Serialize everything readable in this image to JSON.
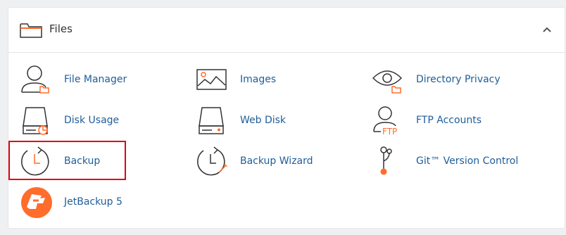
{
  "section": {
    "title": "Files",
    "items": [
      {
        "label": "File Manager",
        "icon": "file-manager-icon"
      },
      {
        "label": "Images",
        "icon": "images-icon"
      },
      {
        "label": "Directory Privacy",
        "icon": "directory-privacy-icon"
      },
      {
        "label": "Disk Usage",
        "icon": "disk-usage-icon"
      },
      {
        "label": "Web Disk",
        "icon": "web-disk-icon"
      },
      {
        "label": "FTP Accounts",
        "icon": "ftp-accounts-icon",
        "icon_text": "FTP"
      },
      {
        "label": "Backup",
        "icon": "backup-icon"
      },
      {
        "label": "Backup Wizard",
        "icon": "backup-wizard-icon"
      },
      {
        "label": "Git™ Version Control",
        "icon": "git-version-control-icon"
      },
      {
        "label": "JetBackup 5",
        "icon": "jetbackup-icon"
      }
    ]
  },
  "highlighted_item": "Backup",
  "colors": {
    "accent": "#ff6c2c",
    "link": "#1f5d99",
    "icon_stroke": "#333333",
    "highlight": "#e3000f"
  }
}
